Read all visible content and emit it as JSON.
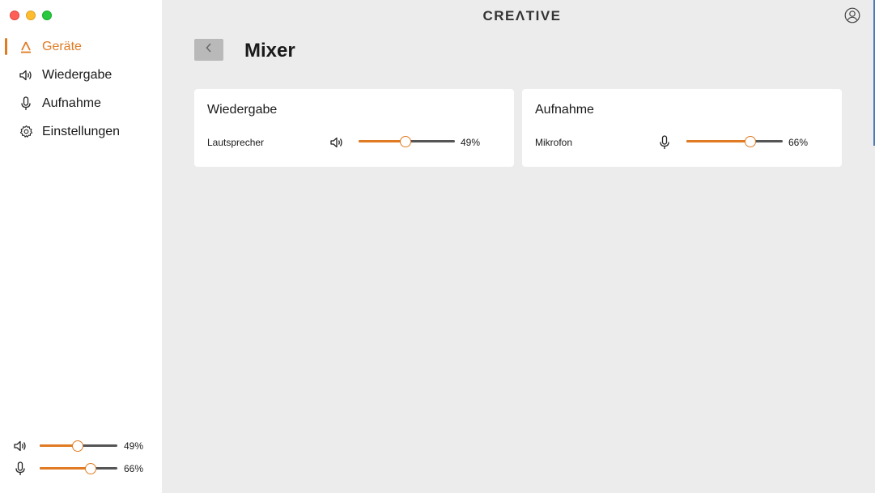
{
  "brand": "CREΛTIVE",
  "colors": {
    "accent": "#e07b23",
    "track": "#555555",
    "main_bg": "#ececec"
  },
  "sidebar": {
    "items": [
      {
        "label": "Geräte",
        "icon": "devices-icon",
        "active": true
      },
      {
        "label": "Wiedergabe",
        "icon": "speaker-icon",
        "active": false
      },
      {
        "label": "Aufnahme",
        "icon": "microphone-icon",
        "active": false
      },
      {
        "label": "Einstellungen",
        "icon": "gear-icon",
        "active": false
      }
    ],
    "mini_sliders": [
      {
        "icon": "speaker-icon",
        "value": 49,
        "value_label": "49%"
      },
      {
        "icon": "microphone-icon",
        "value": 66,
        "value_label": "66%"
      }
    ]
  },
  "header": {
    "title": "Mixer",
    "back_icon": "chevron-left-icon",
    "account_icon": "account-icon"
  },
  "cards": [
    {
      "title": "Wiedergabe",
      "row_label": "Lautsprecher",
      "icon": "speaker-icon",
      "value": 49,
      "value_label": "49%"
    },
    {
      "title": "Aufnahme",
      "row_label": "Mikrofon",
      "icon": "microphone-icon",
      "value": 66,
      "value_label": "66%"
    }
  ]
}
